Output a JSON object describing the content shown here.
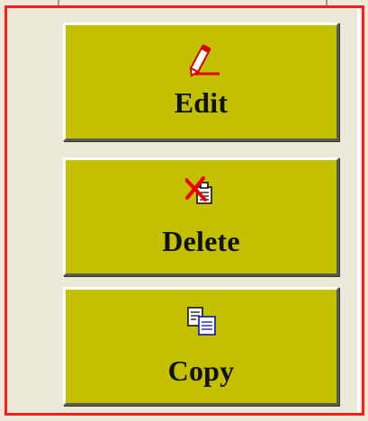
{
  "panel": {
    "border_color": "#ff1a1a",
    "background": "#ece9d8"
  },
  "buttons": {
    "button_color": "#c3c000",
    "edit": {
      "label": "Edit",
      "icon": "pencil-icon"
    },
    "delete": {
      "label": "Delete",
      "icon": "delete-document-icon"
    },
    "copy": {
      "label": "Copy",
      "icon": "copy-documents-icon"
    }
  }
}
